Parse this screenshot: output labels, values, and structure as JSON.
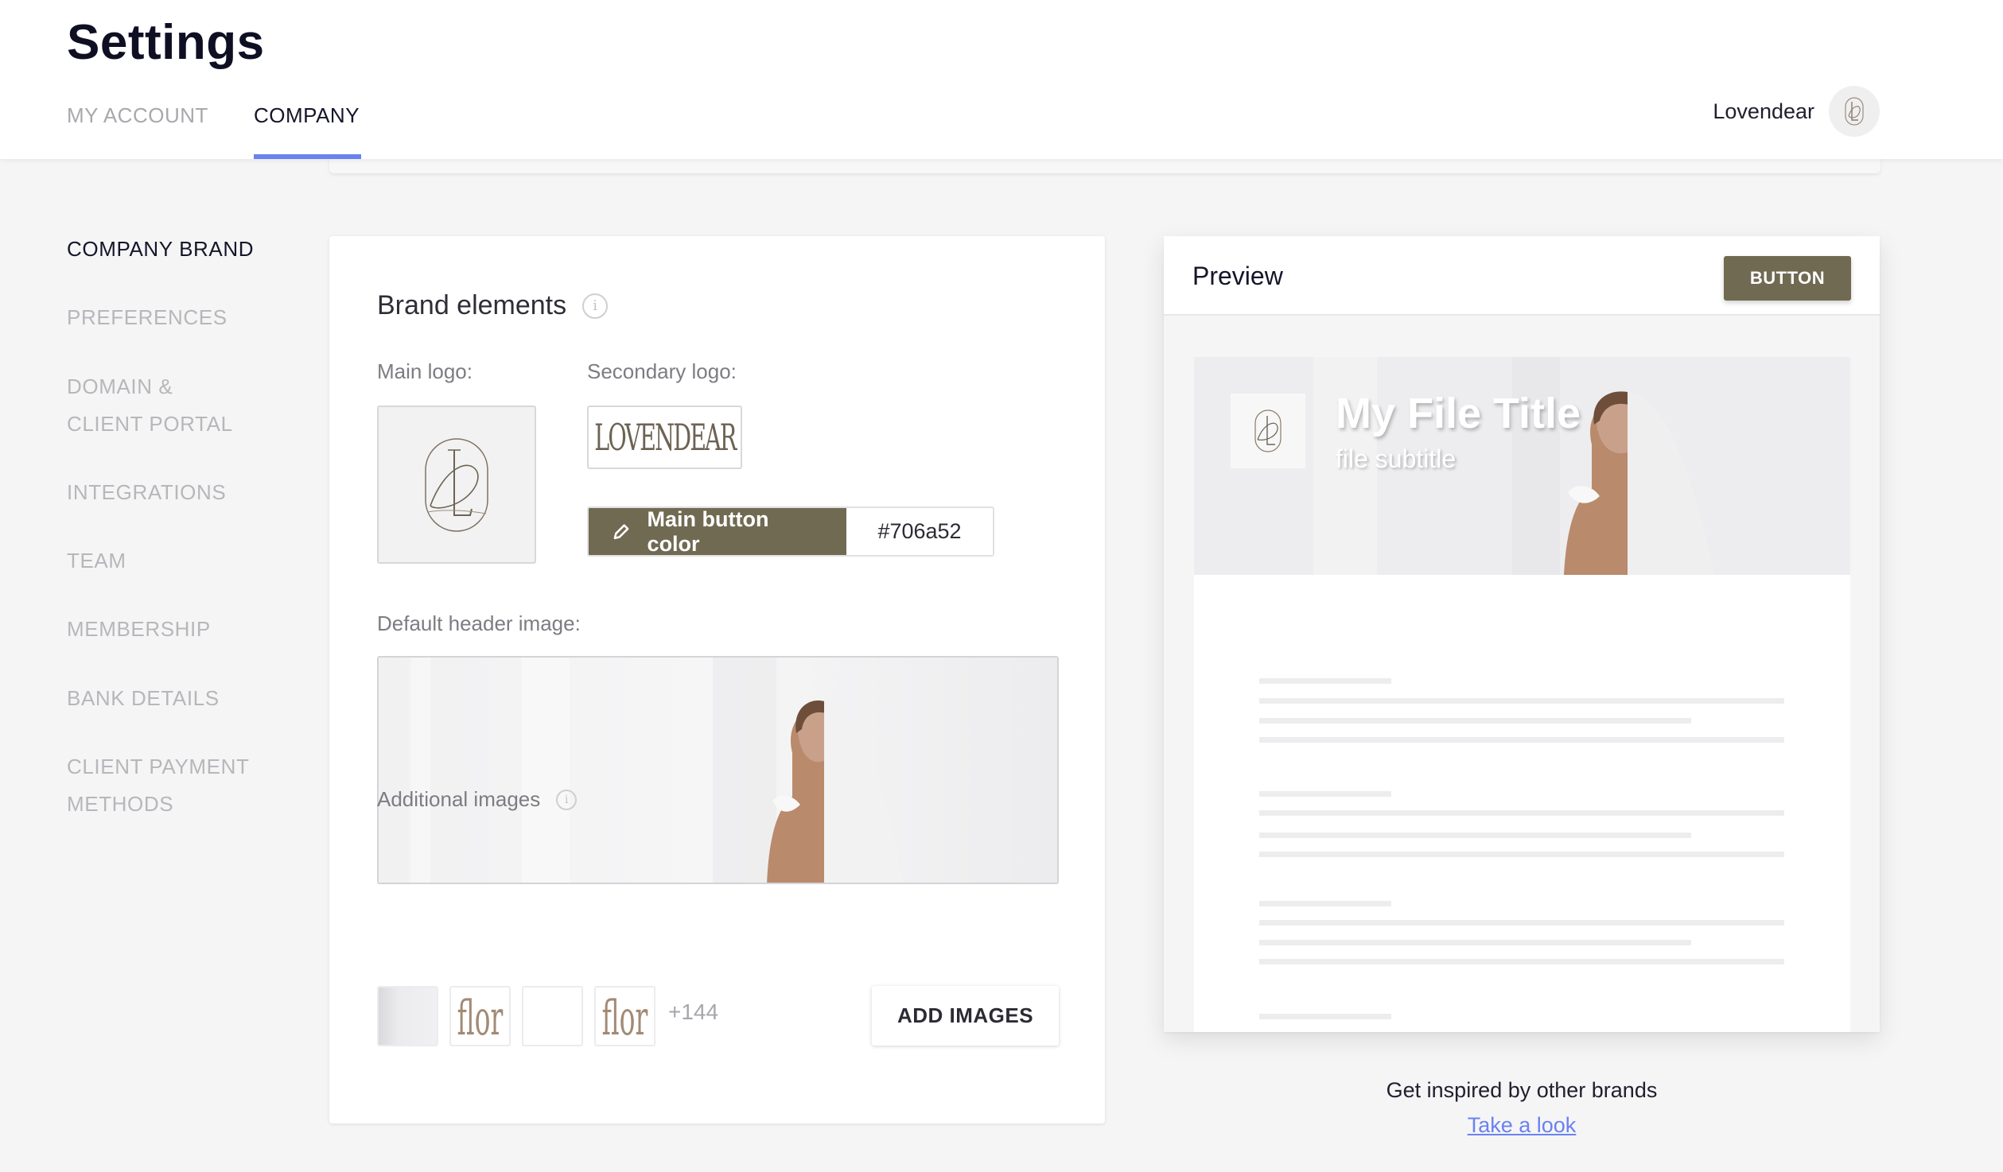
{
  "header": {
    "title": "Settings",
    "tabs": [
      {
        "label": "MY ACCOUNT",
        "active": false
      },
      {
        "label": "COMPANY",
        "active": true
      }
    ],
    "user_name": "Lovendear",
    "accent_color": "#6a82f0"
  },
  "sidebar": {
    "items": [
      {
        "label": "COMPANY BRAND",
        "active": true
      },
      {
        "label": "PREFERENCES",
        "active": false
      },
      {
        "label": "DOMAIN &",
        "label2": "CLIENT PORTAL",
        "active": false
      },
      {
        "label": "INTEGRATIONS",
        "active": false
      },
      {
        "label": "TEAM",
        "active": false
      },
      {
        "label": "MEMBERSHIP",
        "active": false
      },
      {
        "label": "BANK DETAILS",
        "active": false
      },
      {
        "label": "CLIENT PAYMENT",
        "label2": "METHODS",
        "active": false
      }
    ]
  },
  "brand": {
    "section_title": "Brand elements",
    "info_icon": "info-icon",
    "main_logo_label": "Main logo:",
    "main_logo_monogram": "DL",
    "secondary_logo_label": "Secondary logo:",
    "secondary_logo_text": "LOVENDEAR",
    "main_button_color_label": "Main button color",
    "main_button_color_value": "#706a52",
    "edit_icon": "pencil-icon",
    "default_header_label": "Default header image:",
    "additional_images_label": "Additional images",
    "additional_thumbs": [
      {
        "type": "image"
      },
      {
        "type": "text",
        "text": "flor"
      },
      {
        "type": "blank"
      },
      {
        "type": "text",
        "text": "flor"
      }
    ],
    "additional_more_count": "+144",
    "add_images_label": "ADD IMAGES"
  },
  "preview": {
    "title": "Preview",
    "button_label": "BUTTON",
    "button_color": "#706a52",
    "file_title": "My File Title",
    "file_subtitle": "file subtitle"
  },
  "inspire": {
    "text": "Get inspired by other brands",
    "link_label": "Take a look"
  }
}
